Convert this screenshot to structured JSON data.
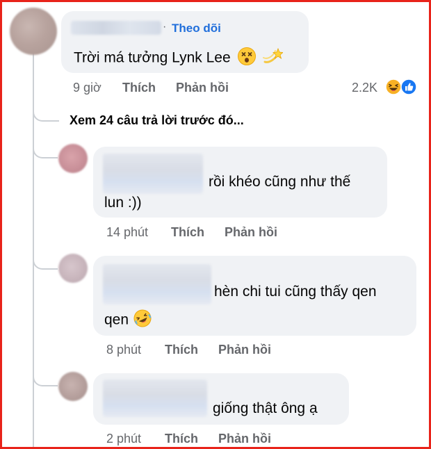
{
  "top_comment": {
    "follow_label": "Theo dõi",
    "separator": "·",
    "text": "Trời má tưởng Lynk Lee",
    "time": "9 giờ",
    "like_label": "Thích",
    "reply_label": "Phản hồi",
    "reaction_count": "2.2K",
    "reaction_icons": [
      "haha-icon",
      "like-icon"
    ],
    "text_emojis": [
      "dizzy-face-emoji",
      "dizzy-star-emoji"
    ]
  },
  "view_more": "Xem 24 câu trả lời trước đó...",
  "replies": [
    {
      "text_line1": "rồi khéo cũng như thế",
      "text_line2": "lun :))",
      "time": "14 phút",
      "like_label": "Thích",
      "reply_label": "Phản hồi"
    },
    {
      "text_line1": "hèn chi tui cũng thấy qen",
      "text_line2": "qen",
      "emoji": "rolling-on-floor-laughing-emoji",
      "time": "8 phút",
      "like_label": "Thích",
      "reply_label": "Phản hồi"
    },
    {
      "text_line1": "giống thật ông ạ",
      "time": "2 phút",
      "like_label": "Thích",
      "reply_label": "Phản hồi"
    }
  ],
  "colors": {
    "frame": "#e8231a",
    "bubble": "#f0f2f5",
    "link": "#216fdb",
    "muted": "#65676b",
    "like_blue": "#1877f2",
    "haha_yellow": "#f7b125"
  }
}
